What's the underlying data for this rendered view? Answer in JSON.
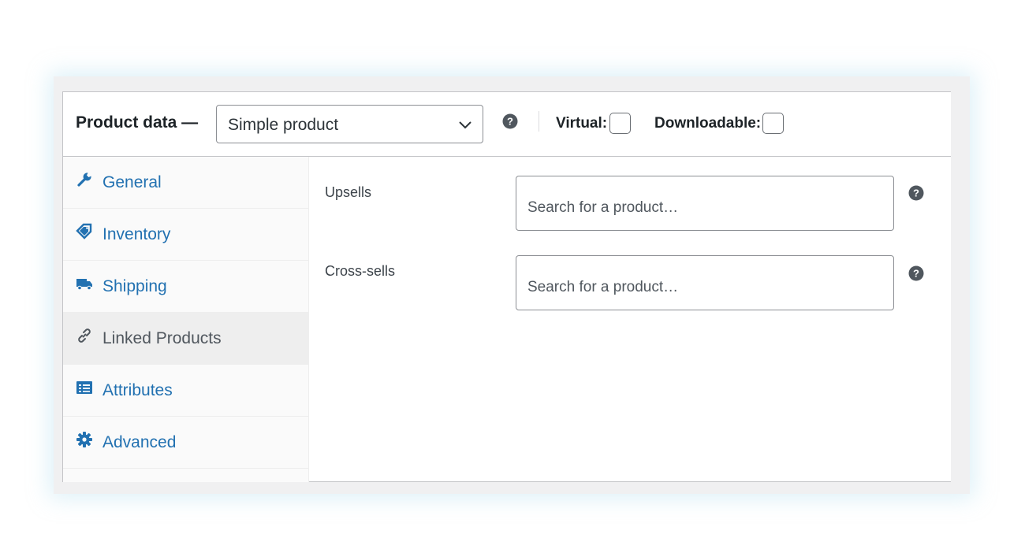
{
  "header": {
    "title": "Product data —",
    "product_type": "Simple product",
    "help_icon": "question-circle-icon",
    "virtual_label": "Virtual:",
    "virtual_checked": false,
    "downloadable_label": "Downloadable:",
    "downloadable_checked": false
  },
  "tabs": [
    {
      "label": "General",
      "icon": "wrench-icon",
      "active": false
    },
    {
      "label": "Inventory",
      "icon": "tag-icon",
      "active": false
    },
    {
      "label": "Shipping",
      "icon": "truck-icon",
      "active": false
    },
    {
      "label": "Linked Products",
      "icon": "link-icon",
      "active": true
    },
    {
      "label": "Attributes",
      "icon": "list-icon",
      "active": false
    },
    {
      "label": "Advanced",
      "icon": "gear-icon",
      "active": false
    }
  ],
  "fields": [
    {
      "label": "Upsells",
      "placeholder": "Search for a product…",
      "help_icon": "question-circle-icon"
    },
    {
      "label": "Cross-sells",
      "placeholder": "Search for a product…",
      "help_icon": "question-circle-icon"
    }
  ],
  "colors": {
    "link": "#2271b1",
    "active_tab_bg": "#eeeeee",
    "help_icon": "#50575e"
  }
}
